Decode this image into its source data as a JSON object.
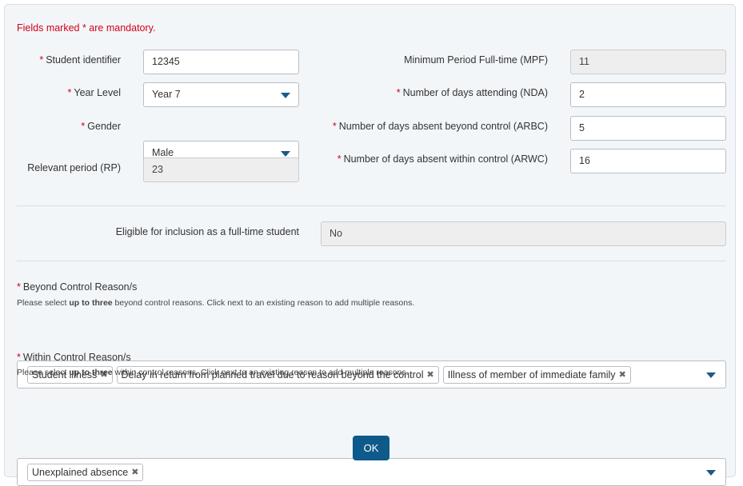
{
  "form": {
    "mandatory_note": "Fields marked * are mandatory.",
    "required_marker": "*",
    "student_identifier": {
      "label": "Student identifier",
      "value": "12345"
    },
    "year_level": {
      "label": "Year Level",
      "value": "Year 7"
    },
    "gender": {
      "label": "Gender",
      "value": "Male"
    },
    "relevant_period": {
      "label": "Relevant period (RP)",
      "value": "23"
    },
    "mpf": {
      "label": "Minimum Period Full-time (MPF)",
      "value": "11"
    },
    "nda": {
      "label": "Number of days attending (NDA)",
      "value": "2"
    },
    "arbc": {
      "label": "Number of days absent beyond control (ARBC)",
      "value": "5"
    },
    "arwc": {
      "label": "Number of days absent within control (ARWC)",
      "value": "16"
    },
    "eligible": {
      "label": "Eligible for inclusion as a full-time student",
      "value": "No"
    },
    "beyond_control": {
      "label": "Beyond Control Reason/s",
      "hint_pre": "Please select ",
      "hint_bold": "up to three",
      "hint_post": " beyond control reasons. Click next to an existing reason to add multiple reasons.",
      "tags": [
        "Student illness",
        "Delay in return from planned travel due to reason beyond the control",
        "Illness of member of immediate family"
      ]
    },
    "within_control": {
      "label": "Within Control Reason/s",
      "hint_pre": "Please select ",
      "hint_bold": "up to three",
      "hint_post": " within control reasons. Click next to an existing reason to add multiple reasons.",
      "tags": [
        "Unexplained absence"
      ]
    },
    "remove_glyph": "✖",
    "ok_label": "OK"
  }
}
